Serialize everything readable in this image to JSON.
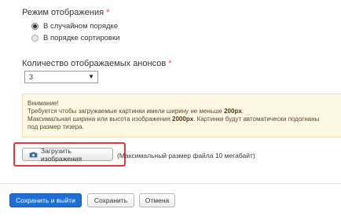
{
  "display_mode": {
    "label": "Режим отображения",
    "required_mark": "*",
    "options": [
      {
        "label": "В случайном порядке",
        "checked": true
      },
      {
        "label": "В порядке сортировки",
        "checked": false
      }
    ]
  },
  "announcements_count": {
    "label": "Количество отображаемых анонсов",
    "required_mark": "*",
    "selected_value": "3"
  },
  "alert": {
    "title": "Внимание!",
    "line1_prefix": "Требуется чтобы загружаемые картинки имели ширину не меньше ",
    "line1_bold": "200px",
    "line1_suffix": ".",
    "line2_prefix": "Максимальная ширина или высота изображения ",
    "line2_bold": "2000px",
    "line2_suffix": ". Картинки будут автоматически подогнаны",
    "line3": "под размер тизера."
  },
  "upload": {
    "button_label": "Загрузить изображения",
    "icon": "camera-icon",
    "hint": "(Максимальный размер файла 10 мегабайт)"
  },
  "actions": {
    "save_exit_label": "Сохранить и выйти",
    "save_label": "Сохранить",
    "cancel_label": "Отмена"
  },
  "colors": {
    "primary": "#1e6fd1",
    "alert_bg": "#fcf8e3",
    "highlight": "#e53935",
    "required": "#d9534f"
  }
}
